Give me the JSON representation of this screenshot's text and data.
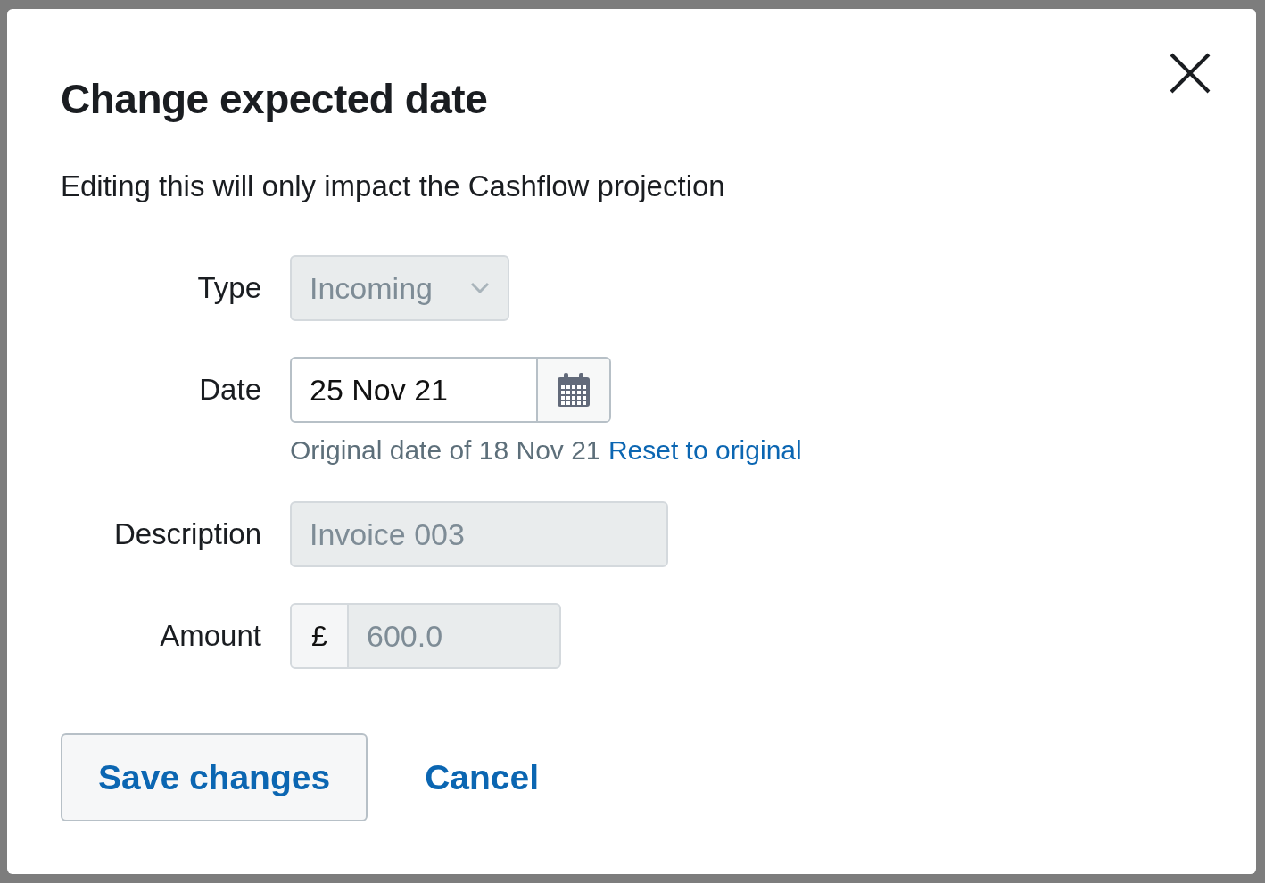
{
  "dialog": {
    "title": "Change expected date",
    "subtitle": "Editing this will only impact the Cashflow projection"
  },
  "fields": [
    {
      "kind": "select",
      "label": "Type",
      "value": "Incoming",
      "disabled": true
    },
    {
      "kind": "date",
      "label": "Date",
      "value": "25 Nov 21",
      "disabled": false,
      "hint": "Original date of 18 Nov 21",
      "hint_link": "Reset to original"
    },
    {
      "kind": "text",
      "label": "Description",
      "value": "Invoice 003",
      "disabled": true
    },
    {
      "kind": "currency",
      "label": "Amount",
      "prefix": "£",
      "value": "600.0",
      "disabled": true
    }
  ],
  "buttons": [
    {
      "kind": "primary",
      "label": "Save changes"
    },
    {
      "kind": "link",
      "label": "Cancel"
    }
  ]
}
